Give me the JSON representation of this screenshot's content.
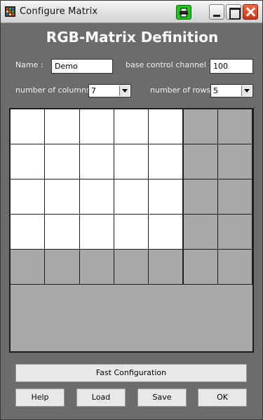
{
  "window": {
    "title": "Configure Matrix"
  },
  "heading": "RGB-Matrix Definition",
  "form": {
    "name_label": "Name :",
    "name_value": "Demo",
    "channel_label": "base control channel :",
    "channel_value": "100",
    "columns_label": "number of columns :",
    "columns_value": "7",
    "rows_label": "number of rows :",
    "rows_value": "5"
  },
  "matrix": {
    "columns": 7,
    "rows": 5,
    "active": [
      [
        1,
        1,
        1,
        1,
        1,
        0,
        0
      ],
      [
        1,
        1,
        1,
        1,
        1,
        0,
        0
      ],
      [
        1,
        1,
        1,
        1,
        1,
        0,
        0
      ],
      [
        1,
        1,
        1,
        1,
        1,
        0,
        0
      ],
      [
        0,
        0,
        0,
        0,
        0,
        0,
        0
      ]
    ],
    "active_color": "#ffffff",
    "inactive_color": "#a9a9a9"
  },
  "buttons": {
    "fast_config": "Fast Configuration",
    "help": "Help",
    "load": "Load",
    "save": "Save",
    "ok": "OK"
  },
  "colors": {
    "background": "#6c6c6c",
    "close_button": "#d64420",
    "special_button": "#1fc21f"
  },
  "icons": {
    "app": "matrix-app-icon",
    "special": "printer-icon",
    "minimize": "minimize-icon",
    "maximize": "maximize-icon",
    "close": "close-icon"
  }
}
